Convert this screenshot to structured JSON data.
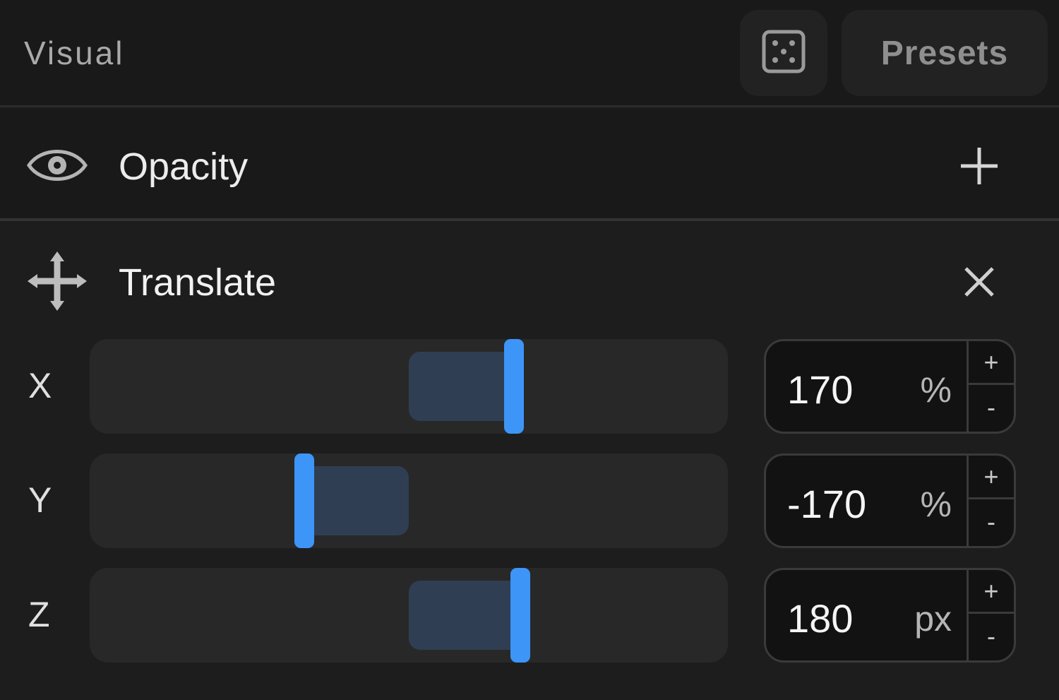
{
  "header": {
    "title": "Visual",
    "dice_icon": "dice-icon",
    "presets_label": "Presets"
  },
  "opacity": {
    "icon": "eye-icon",
    "label": "Opacity",
    "action_icon": "plus-icon"
  },
  "translate": {
    "icon": "move-arrows-icon",
    "label": "Translate",
    "action_icon": "close-icon",
    "accent_color": "#3d95f8",
    "axes": [
      {
        "axis": "X",
        "value": "170",
        "unit": "%",
        "increment": "+",
        "decrement": "-"
      },
      {
        "axis": "Y",
        "value": "-170",
        "unit": "%",
        "increment": "+",
        "decrement": "-"
      },
      {
        "axis": "Z",
        "value": "180",
        "unit": "px",
        "increment": "+",
        "decrement": "-"
      }
    ]
  }
}
